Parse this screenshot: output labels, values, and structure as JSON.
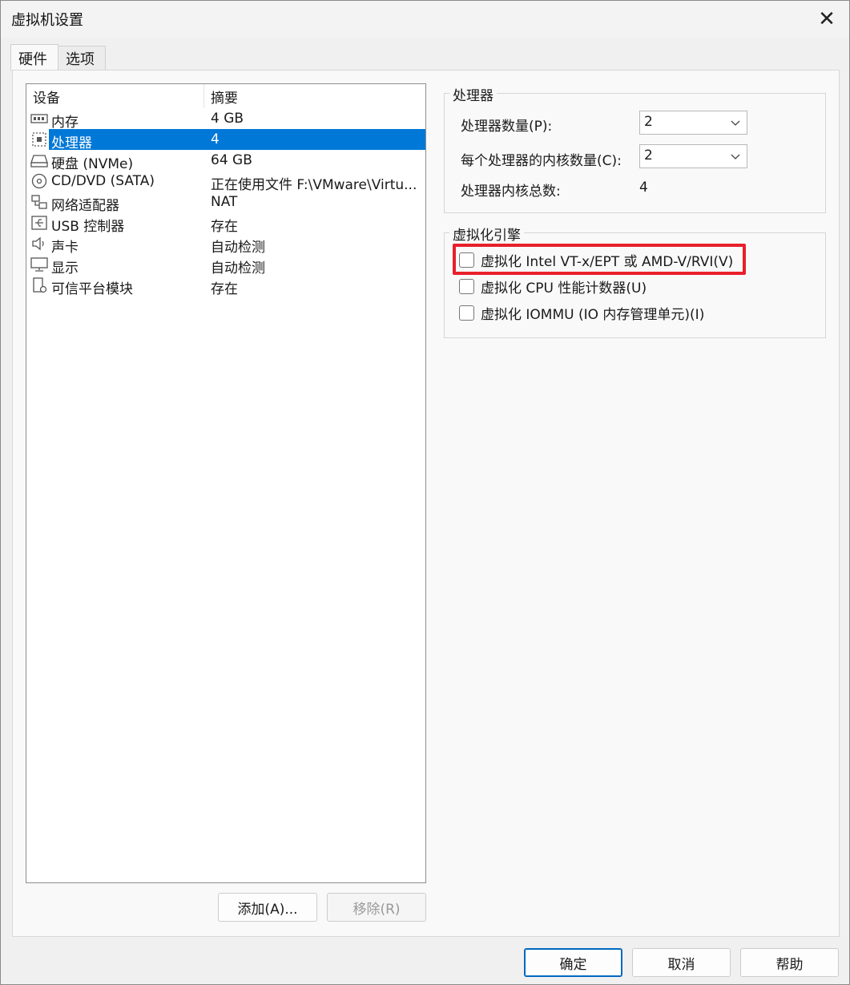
{
  "window": {
    "title": "虚拟机设置",
    "close_symbol": "✕"
  },
  "tabs": [
    {
      "label": "硬件",
      "active": true
    },
    {
      "label": "选项",
      "active": false
    }
  ],
  "device_list": {
    "columns": [
      "设备",
      "摘要"
    ],
    "rows": [
      {
        "icon": "memory-icon",
        "name": "内存",
        "summary": "4 GB"
      },
      {
        "icon": "processor-icon",
        "name": "处理器",
        "summary": "4",
        "selected": true
      },
      {
        "icon": "hard-disk-icon",
        "name": "硬盘 (NVMe)",
        "summary": "64 GB"
      },
      {
        "icon": "cd-dvd-icon",
        "name": "CD/DVD (SATA)",
        "summary": "正在使用文件 F:\\VMware\\Virtu..."
      },
      {
        "icon": "network-adapter-icon",
        "name": "网络适配器",
        "summary": "NAT"
      },
      {
        "icon": "usb-icon",
        "name": "USB 控制器",
        "summary": "存在"
      },
      {
        "icon": "speaker-icon",
        "name": "声卡",
        "summary": "自动检测"
      },
      {
        "icon": "monitor-icon",
        "name": "显示",
        "summary": "自动检测"
      },
      {
        "icon": "tpm-icon",
        "name": "可信平台模块",
        "summary": "存在"
      }
    ]
  },
  "list_buttons": {
    "add": "添加(A)...",
    "remove": "移除(R)"
  },
  "processor_group": {
    "title": "处理器",
    "count_label": "处理器数量(P):",
    "count_value": "2",
    "cores_label": "每个处理器的内核数量(C):",
    "cores_value": "2",
    "total_label": "处理器内核总数:",
    "total_value": "4"
  },
  "virt_group": {
    "title": "虚拟化引擎",
    "options": [
      {
        "label": "虚拟化 Intel VT-x/EPT 或 AMD-V/RVI(V)",
        "checked": false
      },
      {
        "label": "虚拟化 CPU 性能计数器(U)",
        "checked": false
      },
      {
        "label": "虚拟化 IOMMU (IO 内存管理单元)(I)",
        "checked": false
      }
    ]
  },
  "footer_buttons": {
    "ok": "确定",
    "cancel": "取消",
    "help": "帮助"
  },
  "colors": {
    "selection": "#0078d7",
    "highlight": "#e8202a",
    "primary_border": "#0067c0"
  }
}
